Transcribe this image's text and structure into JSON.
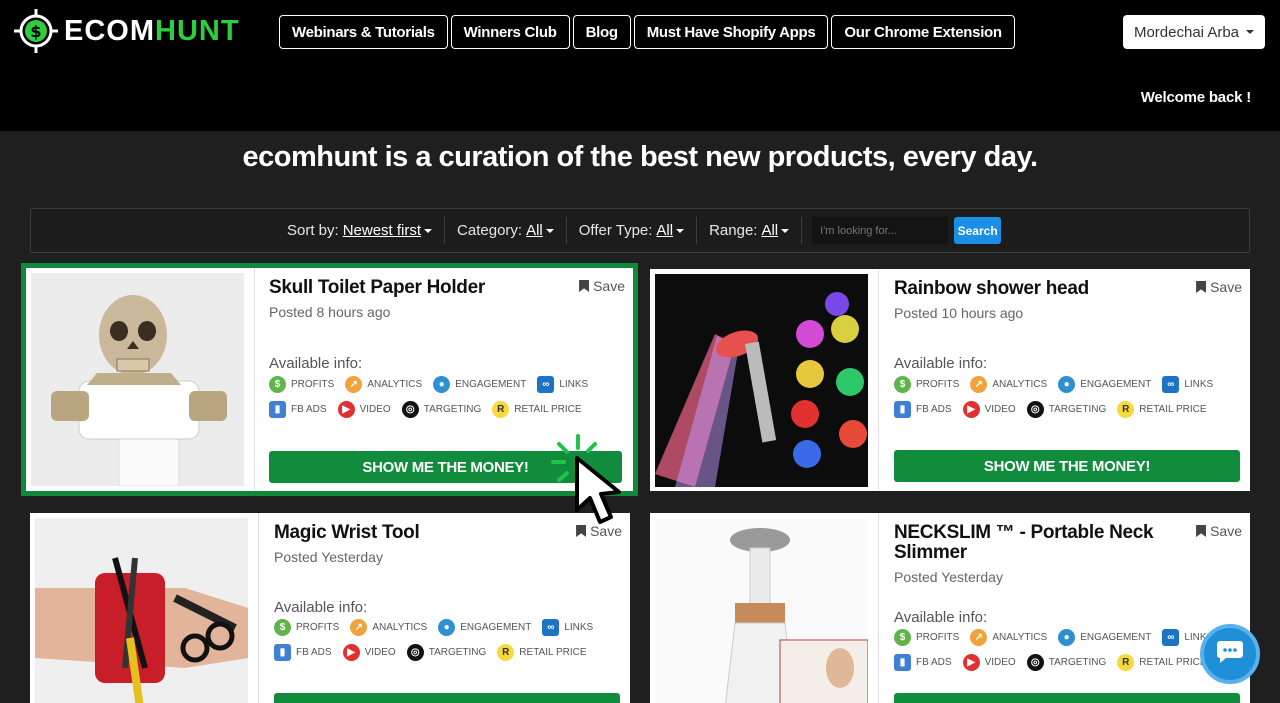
{
  "brand": {
    "logo_prefix": "ECOM",
    "logo_suffix": "HUNT",
    "accent": "#2ecc40",
    "button_green": "#118c3c"
  },
  "nav": {
    "items": [
      {
        "label": "Webinars & Tutorials"
      },
      {
        "label": "Winners Club"
      },
      {
        "label": "Blog"
      },
      {
        "label": "Must Have Shopify Apps"
      },
      {
        "label": "Our Chrome Extension"
      }
    ],
    "user_name": "Mordechai Arba",
    "welcome": "Welcome back !"
  },
  "headline": "ecomhunt is a curation of the best new products, every day.",
  "filters": {
    "sort_label": "Sort by:",
    "sort_value": "Newest first",
    "category_label": "Category:",
    "category_value": "All",
    "offer_label": "Offer Type:",
    "offer_value": "All",
    "range_label": "Range:",
    "range_value": "All",
    "search_placeholder": "I'm looking for...",
    "search_button": "Search"
  },
  "card_common": {
    "save_label": "Save",
    "available_label": "Available info:",
    "info_row1": [
      "PROFITS",
      "ANALYTICS",
      "ENGAGEMENT",
      "LINKS"
    ],
    "info_row2": [
      "FB ADS",
      "VIDEO",
      "TARGETING",
      "RETAIL PRICE"
    ],
    "button_label": "SHOW ME THE MONEY!"
  },
  "products": [
    {
      "title": "Skull Toilet Paper Holder",
      "posted": "Posted 8 hours ago"
    },
    {
      "title": "Rainbow shower head",
      "posted": "Posted 10 hours ago"
    },
    {
      "title": "Magic Wrist Tool",
      "posted": "Posted Yesterday"
    },
    {
      "title": "NECKSLIM ™ - Portable Neck Slimmer",
      "posted": "Posted Yesterday"
    }
  ]
}
